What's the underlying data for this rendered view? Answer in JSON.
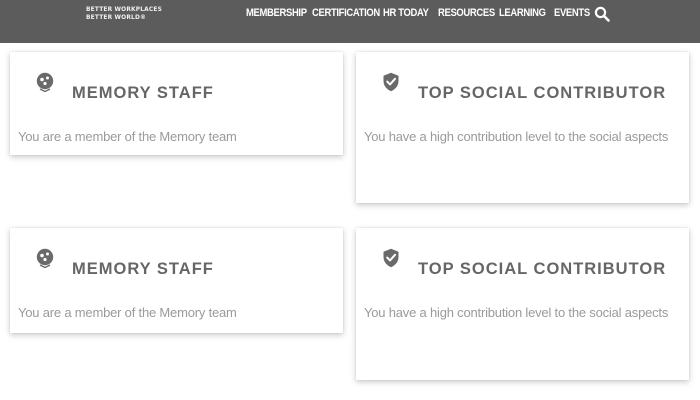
{
  "header": {
    "brand_line1": "BETTER WORKPLACES",
    "brand_line2": "BETTER WORLD®",
    "nav": [
      "MEMBERSHIP",
      "CERTIFICATION",
      "HR TODAY",
      "RESOURCES",
      "LEARNING",
      "EVENTS"
    ],
    "search_icon": "search-icon",
    "bar_color": "#5c5c5c"
  },
  "cards": [
    {
      "icon": "memory-badge-icon",
      "title": "MEMORY STAFF",
      "description": "You are a member of the Memory team"
    },
    {
      "icon": "shield-check-icon",
      "title": "TOP SOCIAL CONTRIBUTOR",
      "description": "You have a high contribution level to the social aspects"
    },
    {
      "icon": "memory-badge-icon",
      "title": "MEMORY STAFF",
      "description": "You are a member of the Memory team"
    },
    {
      "icon": "shield-check-icon",
      "title": "TOP SOCIAL CONTRIBUTOR",
      "description": "You have a high contribution level to the social aspects"
    }
  ]
}
